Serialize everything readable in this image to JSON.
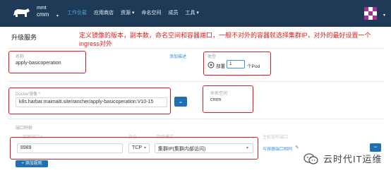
{
  "header": {
    "cluster": "mmt",
    "project": "cmm",
    "nav": [
      {
        "label": "工作负载",
        "active": true
      },
      {
        "label": "应用商店",
        "active": false
      },
      {
        "label": "资源 ▾",
        "active": false
      },
      {
        "label": "命名空间",
        "active": false
      },
      {
        "label": "成员",
        "active": false
      },
      {
        "label": "工具 ▾",
        "active": false
      }
    ],
    "accent": "#48a1e6",
    "bg": "#1f3a56"
  },
  "page": {
    "title": "升级服务",
    "annotation": "定义镜像的版本，副本数，命名空间和容器端口，一般不对外的容器就选择集群IP，对外的最好设置一个ingress对外"
  },
  "form": {
    "name_label": "名称",
    "name_value": "apply-basicoperation",
    "desc_link": "添加描述",
    "scale_label": "类型",
    "deploy_label": "部署",
    "replicas": "1",
    "replicas_unit": "个Pod",
    "image_label": "Docker镜像 *",
    "image_value": "k8s.harbar.maimaiti.site/rancher/apply-basicoperation:V10-15",
    "namespace_label": "命名空间",
    "namespace_value": "cmm",
    "port_section": "端口映射",
    "port_value": "8989",
    "protocol_value": "TCP",
    "service_type": "集群IP(集群内部访问)",
    "same_port_link": "与容器端口相同",
    "add_rule": "添加规则"
  },
  "watermark": "云时代IT运维"
}
